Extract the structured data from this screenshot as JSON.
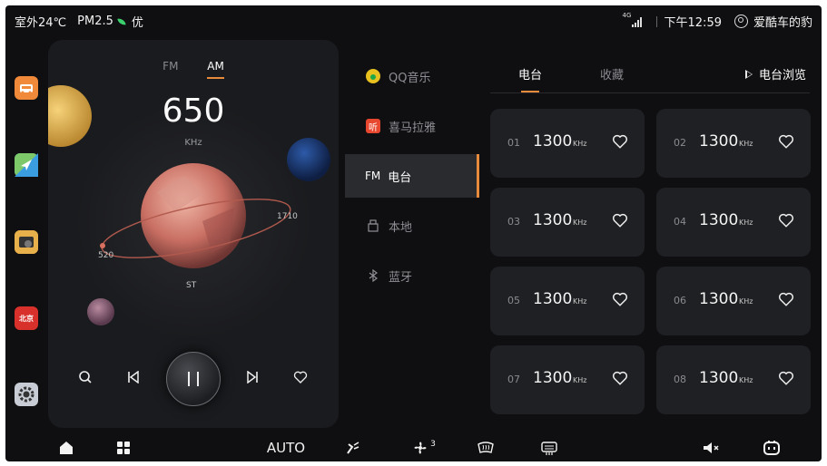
{
  "status_bar": {
    "outdoor_temp": "室外24℃",
    "pm25": "PM2.5",
    "air_quality": "优",
    "network": "4G",
    "time": "下午12:59",
    "username": "爱酷车的豹"
  },
  "dock": {
    "apps": [
      {
        "icon": "car-app-icon",
        "color": "#f08a3a"
      },
      {
        "icon": "navigation-app-icon",
        "color": "#4db8e8"
      },
      {
        "icon": "media-app-icon",
        "color": "#f0a03a"
      },
      {
        "icon": "beijing-app-icon",
        "color": "#d8302a",
        "label": "北京"
      },
      {
        "icon": "settings-app-icon",
        "color": "#c8ccd4"
      }
    ]
  },
  "radio": {
    "bands": [
      "FM",
      "AM"
    ],
    "active_band": "AM",
    "frequency": "650",
    "unit": "KHz",
    "range_min": "520",
    "range_max": "1710",
    "stereo_label": "ST",
    "tuning_position": 0.11
  },
  "sources": [
    {
      "label": "QQ音乐",
      "icon": "qq-music-icon",
      "color": "#e8c11f"
    },
    {
      "label": "喜马拉雅",
      "icon": "ximalaya-icon",
      "color": "#e8472f",
      "glyph": "听"
    },
    {
      "label": "电台",
      "icon": "fm-icon",
      "prefix": "FM",
      "active": true
    },
    {
      "label": "本地",
      "icon": "usb-icon"
    },
    {
      "label": "蓝牙",
      "icon": "bluetooth-icon",
      "glyph": "✱"
    }
  ],
  "presets_panel": {
    "tabs": [
      "电台",
      "收藏"
    ],
    "active_tab": "电台",
    "browse_label": "电台浏览",
    "presets": [
      {
        "num": "01",
        "freq": "1300",
        "unit": "KHz"
      },
      {
        "num": "02",
        "freq": "1300",
        "unit": "KHz"
      },
      {
        "num": "03",
        "freq": "1300",
        "unit": "KHz"
      },
      {
        "num": "04",
        "freq": "1300",
        "unit": "KHz"
      },
      {
        "num": "05",
        "freq": "1300",
        "unit": "KHz"
      },
      {
        "num": "06",
        "freq": "1300",
        "unit": "KHz"
      },
      {
        "num": "07",
        "freq": "1300",
        "unit": "KHz"
      },
      {
        "num": "08",
        "freq": "1300",
        "unit": "KHz"
      }
    ]
  },
  "bottom_bar": {
    "climate_mode": "AUTO",
    "fan_level": "3"
  },
  "colors": {
    "accent": "#e88a3c",
    "background": "#0f0f11",
    "card": "#1f2023"
  }
}
